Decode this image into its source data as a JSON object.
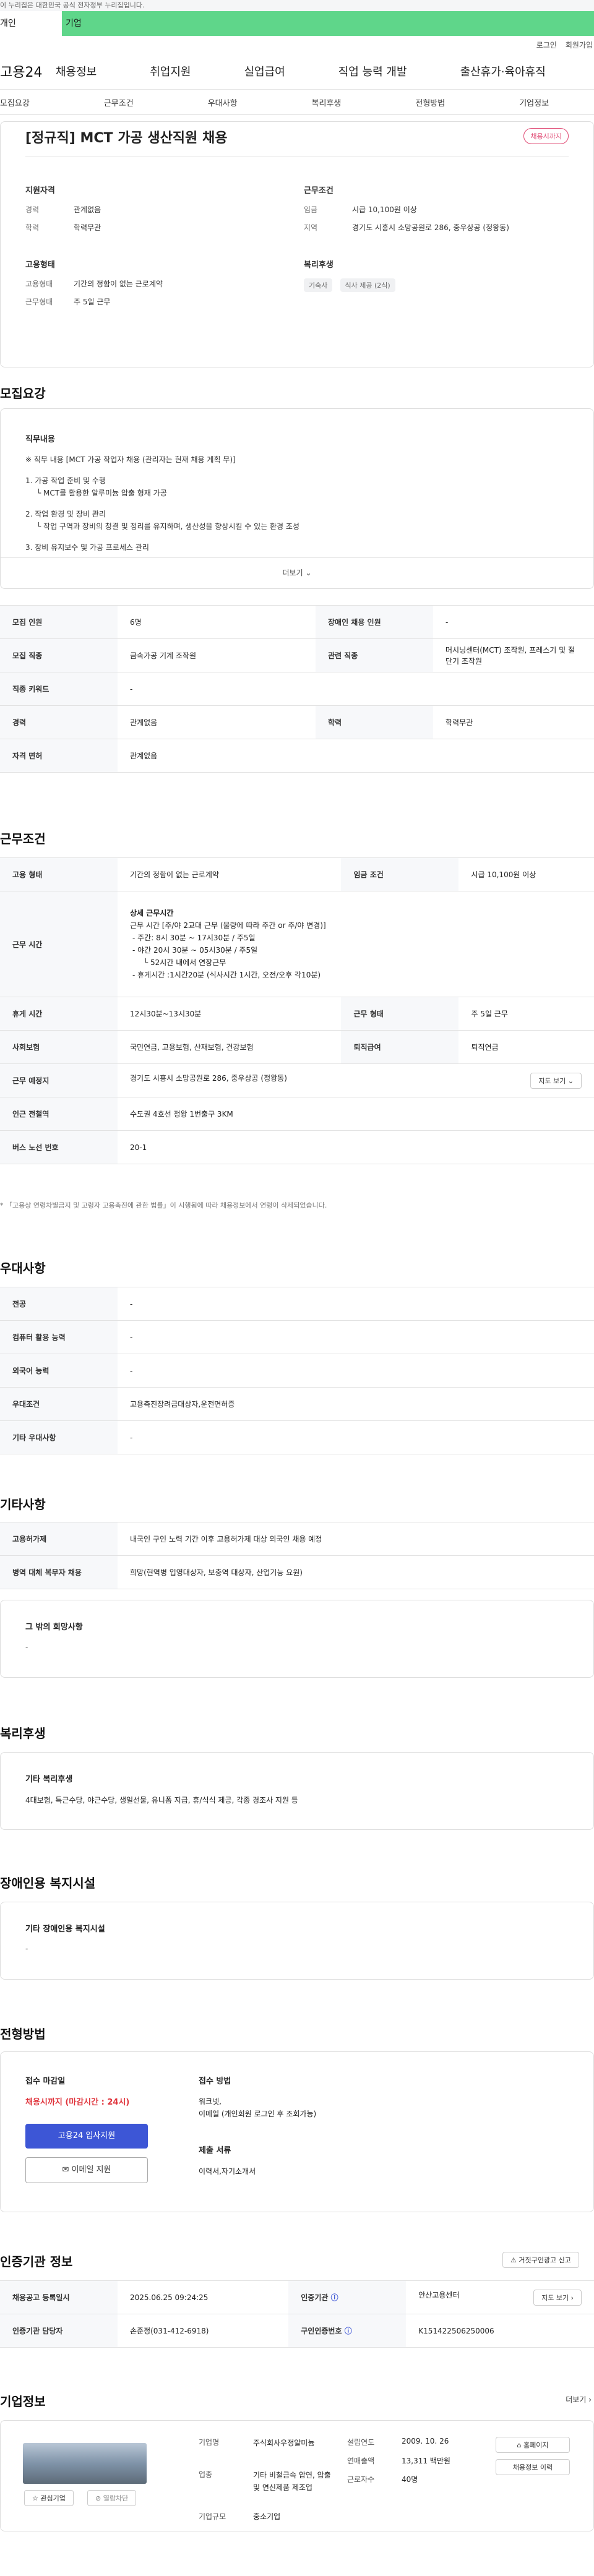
{
  "gov_banner": "이 누리집은 대한민국 공식 전자정부 누리집입니다.",
  "topbar": {
    "personal": "개인",
    "company": "기업"
  },
  "util": {
    "login": "로그인",
    "join": "회원가입"
  },
  "logo": "고용24",
  "gnb": [
    "채용정보",
    "취업지원",
    "실업급여",
    "직업 능력 개발",
    "출산휴가·육아휴직"
  ],
  "subnav": [
    "모집요강",
    "근무조건",
    "우대사항",
    "복리후생",
    "전형방법",
    "기업정보"
  ],
  "job": {
    "title": "[정규직] MCT 가공 생산직원 채용",
    "badge": "채용시까지",
    "qual_h": "지원자격",
    "qual": [
      {
        "k": "경력",
        "v": "관계없음"
      },
      {
        "k": "학력",
        "v": "학력무관"
      }
    ],
    "cond_h": "근무조건",
    "cond": [
      {
        "k": "임금",
        "v": "시급 10,100원 이상"
      },
      {
        "k": "지역",
        "v": "경기도 시흥시 소망공원로 286, 중우상공 (정왕동)"
      }
    ],
    "emp_h": "고용형태",
    "emp": [
      {
        "k": "고용형태",
        "v": "기간의 정함이 없는 근로계약"
      },
      {
        "k": "근무형태",
        "v": "주 5일 근무"
      }
    ],
    "welfare_h": "복리후생",
    "welfare_chips": [
      "기숙사",
      "식사 제공 (2식)"
    ]
  },
  "recruit": {
    "title": "모집요강",
    "duty_h": "직무내용",
    "duty_lines": [
      "※ 직무 내용 [MCT 가공 작업자 채용 (관리자는 현재 채용 계획 무)]",
      "1. 가공 작업 준비 및 수행",
      "└ MCT를 활용한 알루미늄 압출 형재 가공",
      "2. 작업 환경 및 장비 관리",
      "└ 작업 구역과 장비의 청결 및 정리를 유지하며, 생산성을 향상시킬 수 있는 환경 조성",
      "3. 장비 유지보수 및 가공 프로세스 관리"
    ],
    "more": "더보기",
    "rows": [
      {
        "k1": "모집 인원",
        "v1": "6명",
        "k2": "장애인 채용 인원",
        "v2": "-"
      },
      {
        "k1": "모집 직종",
        "v1": "금속가공 기계 조작원",
        "k2": "관련 직종",
        "v2": "머시닝센터(MCT) 조작원, 프레스기 및 절단기 조작원"
      },
      {
        "k1": "직종 키워드",
        "v1": "-",
        "k2": "",
        "v2": ""
      },
      {
        "k1": "경력",
        "v1": "관계없음",
        "k2": "학력",
        "v2": "학력무관"
      },
      {
        "k1": "자격 면허",
        "v1": "관계없음",
        "k2": "",
        "v2": ""
      }
    ]
  },
  "work": {
    "title": "근무조건",
    "emp_type_k": "고용 형태",
    "emp_type_v": "기간의 정함이 없는 근로계약",
    "wage_k": "임금 조건",
    "wage_v": "시급 10,100원 이상",
    "hours_k": "근무 시간",
    "hours_h": "상세 근무시간",
    "hours_lines": [
      "근무 시간 [주/야 2교대 근무 (물량에 따라 주간 or 주/야 변경)]",
      "- 주간: 8시 30분 ~ 17시30분 / 주5일",
      "- 야간 20시 30분 ~ 05시30분 / 주5일",
      "└ 52시간 내에서 연장근무",
      "- 휴게시간 :1시간20분 (식사시간 1시간, 오전/오후 각10분)"
    ],
    "break_k": "휴게 시간",
    "break_v": "12시30분~13시30분",
    "form_k": "근무 형태",
    "form_v": "주 5일 근무",
    "ins_k": "사회보험",
    "ins_v": "국민연금, 고용보험, 산재보험, 건강보험",
    "ret_k": "퇴직급여",
    "ret_v": "퇴직연금",
    "place_k": "근무 예정지",
    "place_v": "경기도 시흥시 소망공원로 286, 중우상공 (정왕동)",
    "map_btn": "지도 보기",
    "subway_k": "인근 전철역",
    "subway_v": "수도권 4호선 정왕 1번출구 3KM",
    "bus_k": "버스 노선 번호",
    "bus_v": "20-1",
    "note": "* 「고용상 연령차별금지 및 고령자 고용촉진에 관한 법률」이 시행됨에 따라 채용정보에서 연령이 삭제되었습니다."
  },
  "pref": {
    "title": "우대사항",
    "rows": [
      {
        "k": "전공",
        "v": "-"
      },
      {
        "k": "컴퓨터 활용 능력",
        "v": "-"
      },
      {
        "k": "외국어 능력",
        "v": "-"
      },
      {
        "k": "우대조건",
        "v": "고용촉진장려금대상자,운전면허증"
      },
      {
        "k": "기타 우대사항",
        "v": "-"
      }
    ]
  },
  "etc": {
    "title": "기타사항",
    "rows": [
      {
        "k": "고용허가제",
        "v": "내국인 구인 노력 기간 이후 고용허가제 대상 외국인 채용 예정"
      },
      {
        "k": "병역 대체 복무자 채용",
        "v": "희망(현역병 입영대상자, 보충역 대상자, 산업기능 요원)"
      }
    ],
    "hope_h": "그 밖의 희망사항",
    "hope_v": "-"
  },
  "benefit": {
    "title": "복리후생",
    "h": "기타 복리후생",
    "v": "4대보험, 특근수당, 야근수당, 생일선물, 유니폼 지급, 휴/식식 제공, 각종 경조사 지원 등"
  },
  "disab": {
    "title": "장애인용 복지시설",
    "h": "기타 장애인용 복지시설",
    "v": "-"
  },
  "process": {
    "title": "전형방법",
    "deadline_h": "접수 마감일",
    "deadline_v": "채용시까지 (마감시간 : 24시)",
    "apply_btn": "고용24 입사지원",
    "email_btn": "이메일 지원",
    "method_h": "접수 방법",
    "method_v1": "워크넷,",
    "method_v2": "이메일 (개인회원 로그인 후 조회가능)",
    "docs_h": "제출 서류",
    "docs_v": "이력서,자기소개서"
  },
  "cert": {
    "title": "인증기관 정보",
    "report_btn": "거짓구인광고 신고",
    "r1k1": "채용공고 등록일시",
    "r1v1": "2025.06.25 09:24:25",
    "r1k2": "인증기관",
    "r1v2": "안산고용센터",
    "map_btn": "지도 보기",
    "r2k1": "인증기관 담당자",
    "r2v1": "손준정(031-412-6918)",
    "r2k2": "구인인증번호",
    "r2v2": "K151422506250006"
  },
  "company": {
    "title": "기업정보",
    "more": "더보기",
    "fav": "관심기업",
    "block": "열람차단",
    "name_k": "기업명",
    "name_v": "주식회사우정알미늄",
    "ind_k": "업종",
    "ind_v": "기타 비철금속 압연, 압출 및 연신제품 제조업",
    "size_k": "기업규모",
    "size_v": "중소기업",
    "est_k": "설립연도",
    "est_v": "2009. 10. 26",
    "sales_k": "연매출액",
    "sales_v": "13,311 백만원",
    "emp_k": "근로자수",
    "emp_v": "40명",
    "home_btn": "홈페이지",
    "jobs_btn": "채용정보 이력"
  }
}
